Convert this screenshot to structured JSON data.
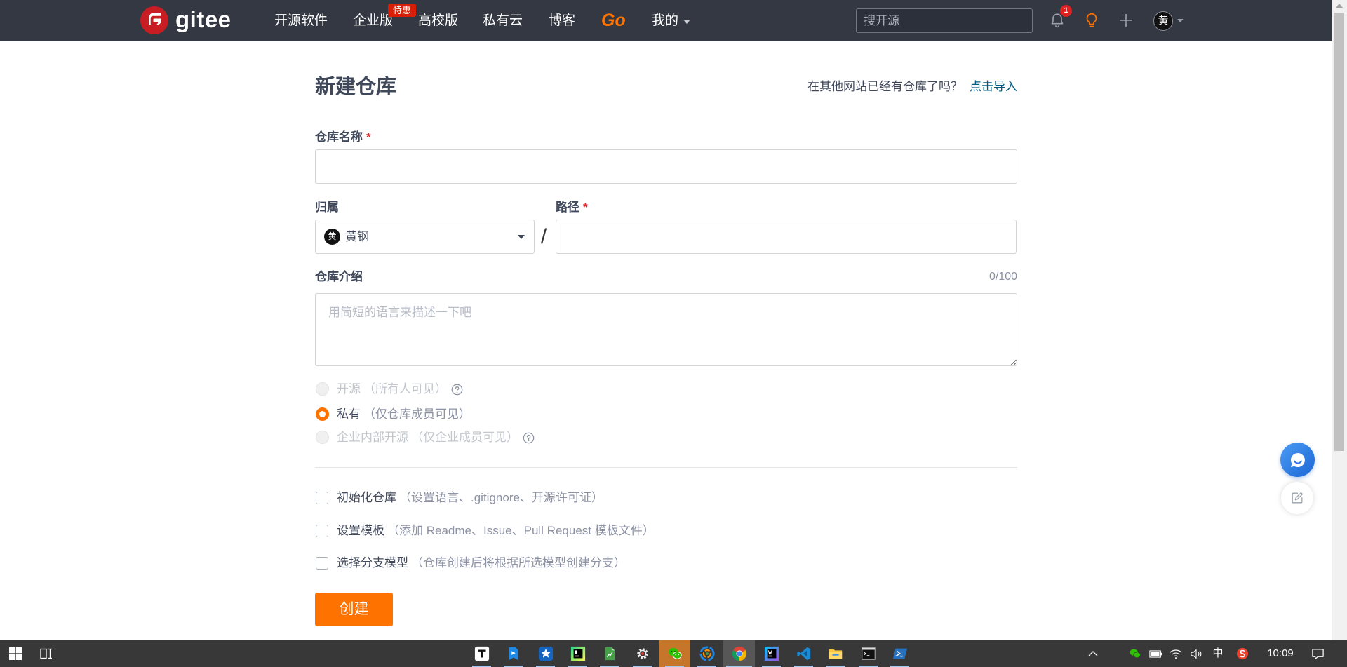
{
  "header": {
    "logo_text": "gitee",
    "nav": [
      {
        "label": "开源软件"
      },
      {
        "label": "企业版",
        "badge": "特惠"
      },
      {
        "label": "高校版"
      },
      {
        "label": "私有云"
      },
      {
        "label": "博客"
      },
      {
        "label": "Go"
      },
      {
        "label": "我的"
      }
    ],
    "search_placeholder": "搜开源",
    "notification_count": "1",
    "avatar_initial": "黄",
    "icons": [
      "bell-icon",
      "lightbulb-icon",
      "plus-icon",
      "chevron-down-icon"
    ]
  },
  "page": {
    "title": "新建仓库",
    "import_prompt": "在其他网站已经有仓库了吗？",
    "import_link": "点击导入"
  },
  "form": {
    "name": {
      "label": "仓库名称",
      "required": "*"
    },
    "owner": {
      "label": "归属",
      "value": "黄钢",
      "avatar_initial": "黄"
    },
    "separator": "/",
    "path": {
      "label": "路径",
      "required": "*"
    },
    "description": {
      "label": "仓库介绍",
      "counter": "0/100",
      "placeholder": "用简短的语言来描述一下吧"
    },
    "visibility": [
      {
        "label": "开源",
        "hint": "（所有人可见）",
        "selected": false,
        "disabled": true,
        "help_icon": "question-circle-icon"
      },
      {
        "label": "私有",
        "hint": "（仅仓库成员可见）",
        "selected": true,
        "disabled": false
      },
      {
        "label": "企业内部开源",
        "hint": "（仅企业成员可见）",
        "selected": false,
        "disabled": true,
        "help_icon": "question-circle-icon"
      }
    ],
    "options": [
      {
        "label": "初始化仓库",
        "hint": "（设置语言、.gitignore、开源许可证）",
        "checked": false
      },
      {
        "label": "设置模板",
        "hint": "（添加 Readme、Issue、Pull Request 模板文件）",
        "checked": false
      },
      {
        "label": "选择分支模型",
        "hint": "（仓库创建后将根据所选模型创建分支）",
        "checked": false
      }
    ],
    "submit_label": "创建"
  },
  "floating": {
    "primary_icon": "chat-bubble-icon",
    "secondary_icon": "edit-icon"
  },
  "taskbar": {
    "start_icon": "windows-logo-icon",
    "task_view_icon": "task-view-icon",
    "apps": [
      {
        "icon": "typora-icon"
      },
      {
        "icon": "bookmark-app-icon"
      },
      {
        "icon": "star-app-icon"
      },
      {
        "icon": "pycharm-icon"
      },
      {
        "icon": "document-app-icon"
      },
      {
        "icon": "settings-gear-icon"
      },
      {
        "icon": "wechat-icon",
        "attention": true
      },
      {
        "icon": "swirl-app-icon"
      },
      {
        "icon": "chrome-icon",
        "active": true
      },
      {
        "icon": "webstorm-icon"
      },
      {
        "icon": "vscode-icon"
      },
      {
        "icon": "file-explorer-icon"
      },
      {
        "icon": "terminal-icon"
      },
      {
        "icon": "powershell-icon"
      }
    ],
    "tray": {
      "ime": "中",
      "time": "10:09",
      "icons": [
        "chevron-up-icon",
        "wechat-tray-icon",
        "battery-icon",
        "wifi-icon",
        "volume-icon",
        "sogou-icon",
        "notification-center-icon"
      ]
    }
  },
  "colors": {
    "accent": "#fe7300",
    "header_bg": "#333843",
    "link": "#005980",
    "required": "#db2828",
    "text": "#40485b",
    "badge": "#d81e06"
  }
}
